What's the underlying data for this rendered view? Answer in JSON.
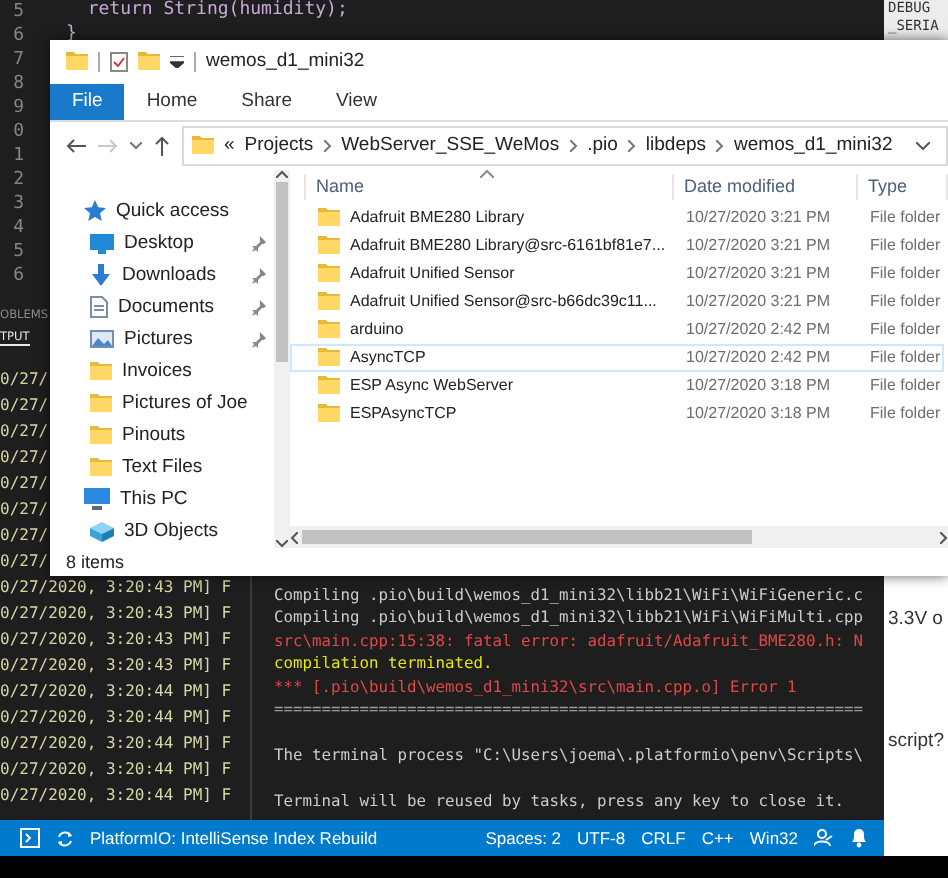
{
  "editor": {
    "line_numbers": [
      "5",
      "6",
      "7",
      "8",
      "9",
      "0",
      "1",
      "2",
      "3",
      "4",
      "5",
      "6"
    ],
    "code_lines": [
      "  return String(humidity);",
      "}"
    ]
  },
  "output_panel": {
    "tabs": [
      {
        "label": "OBLEMS",
        "selected": false
      },
      {
        "label": "TPUT",
        "selected": true
      }
    ],
    "lines": [
      "0/27/",
      "0/27/",
      "0/27/",
      "0/27/",
      "0/27/",
      "0/27/",
      "0/27/",
      "0/27/",
      "0/27/2020, 3:20:43 PM] F",
      "0/27/2020, 3:20:43 PM] F",
      "0/27/2020, 3:20:43 PM] F",
      "0/27/2020, 3:20:43 PM] F",
      "0/27/2020, 3:20:44 PM] F",
      "0/27/2020, 3:20:44 PM] F",
      "0/27/2020, 3:20:44 PM] F",
      "0/27/2020, 3:20:44 PM] F",
      "0/27/2020, 3:20:44 PM] F"
    ]
  },
  "terminal": {
    "lines": [
      {
        "text": "Compiling .pio\\build\\wemos_d1_mini32\\libb21\\WiFi\\WiFiGeneric.c",
        "kind": "plain"
      },
      {
        "text": "Compiling .pio\\build\\wemos_d1_mini32\\libb21\\WiFi\\WiFiMulti.cpp",
        "kind": "plain"
      },
      {
        "text": "src\\main.cpp:15:38: fatal error: adafruit/Adafruit_BME280.h: N",
        "kind": "error"
      },
      {
        "text": "compilation terminated.",
        "kind": "warning"
      },
      {
        "text": "*** [.pio\\build\\wemos_d1_mini32\\src\\main.cpp.o] Error 1",
        "kind": "error"
      },
      {
        "text": "==============================================================",
        "kind": "rule"
      },
      {
        "text": "The terminal process \"C:\\Users\\joema\\.platformio\\penv\\Scripts\\",
        "kind": "notice"
      },
      {
        "text": "Terminal will be reused by tasks, press any key to close it.",
        "kind": "notice"
      }
    ]
  },
  "status_bar": {
    "task": "PlatformIO: IntelliSense Index Rebuild",
    "items": [
      "Spaces: 2",
      "UTF-8",
      "CRLF",
      "C++",
      "Win32"
    ]
  },
  "edge_texts": {
    "top": [
      "DEBUG",
      "_SERIA"
    ],
    "bottom": [
      "3.3V o",
      "script?"
    ]
  },
  "explorer": {
    "title": "wemos_d1_mini32",
    "ribbon_tabs": [
      {
        "label": "File",
        "selected": true
      },
      {
        "label": "Home",
        "selected": false
      },
      {
        "label": "Share",
        "selected": false
      },
      {
        "label": "View",
        "selected": false
      }
    ],
    "address": {
      "overflow": "«",
      "path": [
        "Projects",
        "WebServer_SSE_WeMos",
        ".pio",
        "libdeps",
        "wemos_d1_mini32"
      ]
    },
    "columns": [
      "Name",
      "Date modified",
      "Type"
    ],
    "nav": [
      {
        "label": "Quick access",
        "kind": "star",
        "children": [
          {
            "label": "Desktop",
            "kind": "desktop",
            "pinned": true
          },
          {
            "label": "Downloads",
            "kind": "download",
            "pinned": true
          },
          {
            "label": "Documents",
            "kind": "document",
            "pinned": true
          },
          {
            "label": "Pictures",
            "kind": "pictures",
            "pinned": true
          },
          {
            "label": "Invoices",
            "kind": "folder",
            "pinned": false
          },
          {
            "label": "Pictures of Joe",
            "kind": "folder",
            "pinned": false
          },
          {
            "label": "Pinouts",
            "kind": "folder",
            "pinned": false
          },
          {
            "label": "Text Files",
            "kind": "folder",
            "pinned": false
          }
        ]
      },
      {
        "label": "This PC",
        "kind": "computer",
        "children": [
          {
            "label": "3D Objects",
            "kind": "cube",
            "pinned": false
          }
        ]
      }
    ],
    "files": [
      {
        "name": "Adafruit BME280 Library",
        "date": "10/27/2020 3:21 PM",
        "type": "File folder",
        "hovered": false
      },
      {
        "name": "Adafruit BME280 Library@src-6161bf81e7...",
        "date": "10/27/2020 3:21 PM",
        "type": "File folder",
        "hovered": false
      },
      {
        "name": "Adafruit Unified Sensor",
        "date": "10/27/2020 3:21 PM",
        "type": "File folder",
        "hovered": false
      },
      {
        "name": "Adafruit Unified Sensor@src-b66dc39c11...",
        "date": "10/27/2020 3:21 PM",
        "type": "File folder",
        "hovered": false
      },
      {
        "name": "arduino",
        "date": "10/27/2020 2:42 PM",
        "type": "File folder",
        "hovered": false
      },
      {
        "name": "AsyncTCP",
        "date": "10/27/2020 2:42 PM",
        "type": "File folder",
        "hovered": true
      },
      {
        "name": "ESP Async WebServer",
        "date": "10/27/2020 3:18 PM",
        "type": "File folder",
        "hovered": false
      },
      {
        "name": "ESPAsyncTCP",
        "date": "10/27/2020 3:18 PM",
        "type": "File folder",
        "hovered": false
      }
    ],
    "status": "8 items"
  }
}
